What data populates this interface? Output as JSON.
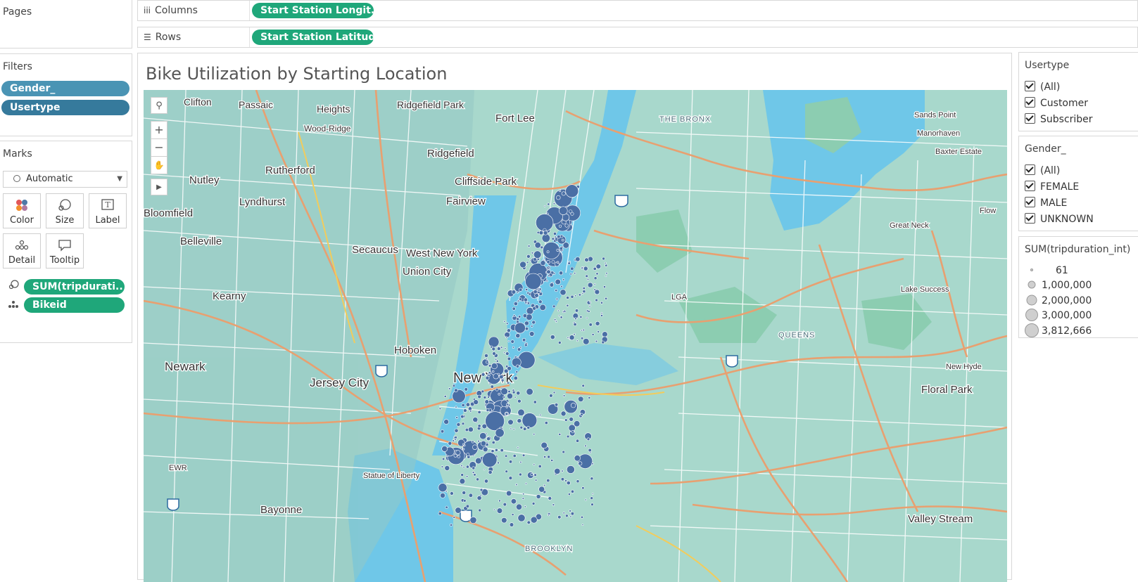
{
  "pages": {
    "title": "Pages"
  },
  "shelves": {
    "columns": {
      "label": "Columns",
      "pill": "Start Station Longit.."
    },
    "rows": {
      "label": "Rows",
      "pill": "Start Station Latitud.."
    }
  },
  "filters": {
    "title": "Filters",
    "pills": [
      "Gender_",
      "Usertype"
    ]
  },
  "marks": {
    "title": "Marks",
    "type_value": "Automatic",
    "buttons": [
      "Color",
      "Size",
      "Label",
      "Detail",
      "Tooltip"
    ],
    "fields": [
      "SUM(tripdurati..",
      "Bikeid"
    ]
  },
  "view": {
    "title": "Bike Utilization by Starting Location"
  },
  "map": {
    "labels": [
      "Clifton",
      "Passaic",
      "Heights",
      "Ridgefield Park",
      "Fort Lee",
      "THE BRONX",
      "Sands Point",
      "Manorhaven",
      "Baxter Estate",
      "Wood-Ridge",
      "Ridgefield",
      "Rutherford",
      "Nutley",
      "Cliffside Park",
      "Fairview",
      "Lyndhurst",
      "Bloomfield",
      "Belleville",
      "Secaucus",
      "West New York",
      "Union City",
      "Kearny",
      "Hoboken",
      "Newark",
      "Jersey City",
      "New York",
      "LGA",
      "QUEENS",
      "Great Neck",
      "Lake Success",
      "New Hyde",
      "Floral Park",
      "Statue of Liberty",
      "EWR",
      "Bayonne",
      "BROOKLYN",
      "Valley Stream",
      "Flow"
    ],
    "colors": {
      "water": "#6fc7e8",
      "land": "#a8d8cc",
      "park": "#93cdb4",
      "roads_major": "#e8a070",
      "roads_minor": "#ffffff",
      "marks": "#4a6fa5"
    }
  },
  "legends": {
    "usertype": {
      "title": "Usertype",
      "items": [
        "(All)",
        "Customer",
        "Subscriber"
      ]
    },
    "gender": {
      "title": "Gender_",
      "items": [
        "(All)",
        "FEMALE",
        "MALE",
        "UNKNOWN"
      ]
    },
    "size": {
      "title": "SUM(tripduration_int)",
      "items": [
        "61",
        "1,000,000",
        "2,000,000",
        "3,000,000",
        "3,812,666"
      ]
    }
  }
}
